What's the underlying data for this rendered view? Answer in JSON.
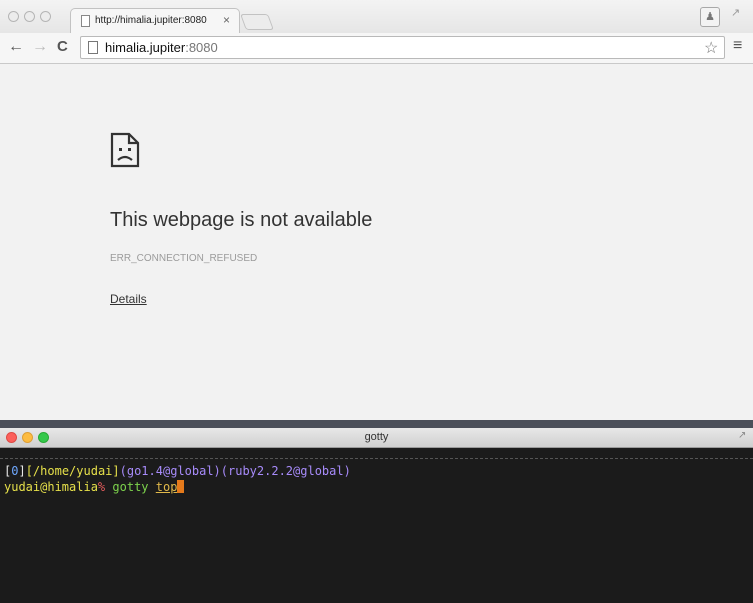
{
  "browser": {
    "tab": {
      "title": "http://himalia.jupiter:8080",
      "close_glyph": "×"
    },
    "toolbar": {
      "back_glyph": "←",
      "forward_glyph": "→",
      "reload_glyph": "C",
      "url_host": "himalia.jupiter",
      "url_port": ":8080",
      "star_glyph": "☆",
      "menu_glyph": "≡"
    },
    "page": {
      "title": "This webpage is not available",
      "error_code": "ERR_CONNECTION_REFUSED",
      "details_link": "Details"
    },
    "icons": [
      "page-icon",
      "close-icon",
      "back-icon",
      "forward-icon",
      "reload-icon",
      "star-icon",
      "menu-icon",
      "profile-icon",
      "sad-page-icon"
    ]
  },
  "terminal": {
    "title": "gotty",
    "prompt": {
      "bracket_open": "[",
      "job": "0",
      "bracket_close": "]",
      "cwd": "[/home/yudai]",
      "go_env": "(go1.4@global)",
      "ruby_env": "(ruby2.2.2@global)"
    },
    "command_line": {
      "user_host": "yudai@himalia",
      "prompt_symbol": "%",
      "command": "gotty",
      "argument": "top"
    }
  },
  "colors": {
    "terminal_bg": "#1b1b1b",
    "cursor": "#e57a1b",
    "close": "#fc605b",
    "minimize": "#fdbc40",
    "maximize": "#34c84a"
  }
}
